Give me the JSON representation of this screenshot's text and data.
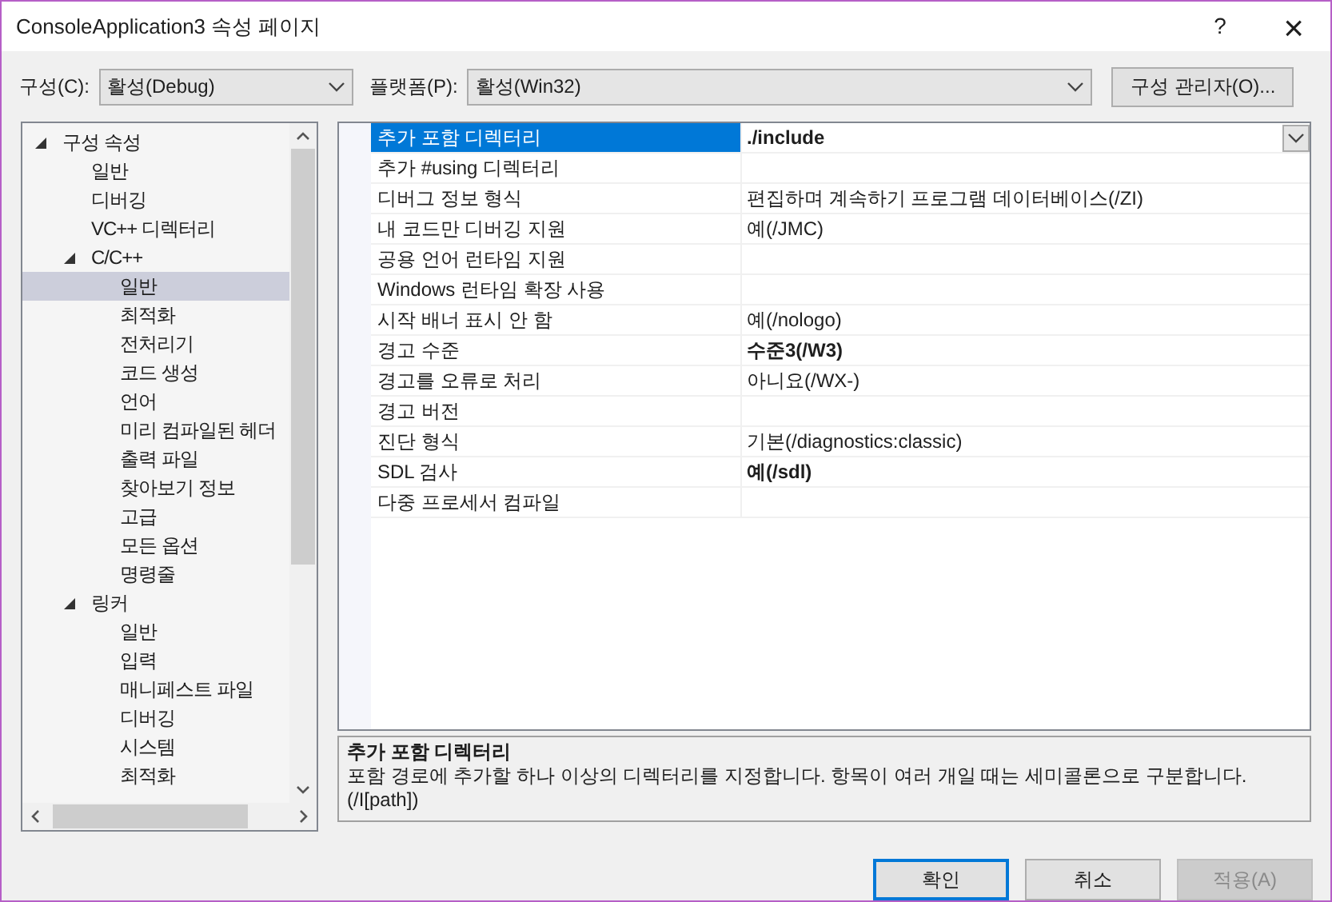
{
  "window": {
    "title": "ConsoleApplication3 속성 페이지",
    "help": "?",
    "close": "×"
  },
  "toolbar": {
    "configuration": {
      "label": "구성(C):",
      "value": "활성(Debug)"
    },
    "platform": {
      "label": "플랫폼(P):",
      "value": "활성(Win32)"
    },
    "manager_button": "구성 관리자(O)..."
  },
  "tree": [
    {
      "label": "구성 속성",
      "expanded": true,
      "selected": false,
      "children": [
        {
          "label": "일반",
          "selected": false
        },
        {
          "label": "디버깅",
          "selected": false
        },
        {
          "label": "VC++ 디렉터리",
          "selected": false
        },
        {
          "label": "C/C++",
          "expanded": true,
          "selected": false,
          "children": [
            {
              "label": "일반",
              "selected": true
            },
            {
              "label": "최적화",
              "selected": false
            },
            {
              "label": "전처리기",
              "selected": false
            },
            {
              "label": "코드 생성",
              "selected": false
            },
            {
              "label": "언어",
              "selected": false
            },
            {
              "label": "미리 컴파일된 헤더",
              "selected": false
            },
            {
              "label": "출력 파일",
              "selected": false
            },
            {
              "label": "찾아보기 정보",
              "selected": false
            },
            {
              "label": "고급",
              "selected": false
            },
            {
              "label": "모든 옵션",
              "selected": false
            },
            {
              "label": "명령줄",
              "selected": false
            }
          ]
        },
        {
          "label": "링커",
          "expanded": true,
          "selected": false,
          "children": [
            {
              "label": "일반",
              "selected": false
            },
            {
              "label": "입력",
              "selected": false
            },
            {
              "label": "매니페스트 파일",
              "selected": false
            },
            {
              "label": "디버깅",
              "selected": false
            },
            {
              "label": "시스템",
              "selected": false
            },
            {
              "label": "최적화",
              "selected": false
            }
          ]
        }
      ]
    }
  ],
  "properties": [
    {
      "name": "추가 포함 디렉터리",
      "value": "./include",
      "bold": true,
      "selected": true
    },
    {
      "name": "추가 #using 디렉터리",
      "selected": false
    },
    {
      "name": "디버그 정보 형식",
      "value": "편집하며 계속하기 프로그램 데이터베이스(/ZI)",
      "bold": false,
      "selected": false
    },
    {
      "name": "내 코드만 디버깅 지원",
      "value": "예(/JMC)",
      "bold": false,
      "selected": false
    },
    {
      "name": "공용 언어 런타임 지원",
      "selected": false
    },
    {
      "name": "Windows 런타임 확장 사용",
      "selected": false
    },
    {
      "name": "시작 배너 표시 안 함",
      "value": "예(/nologo)",
      "bold": false,
      "selected": false
    },
    {
      "name": "경고 수준",
      "value": "수준3(/W3)",
      "bold": true,
      "selected": false
    },
    {
      "name": "경고를 오류로 처리",
      "value": "아니요(/WX-)",
      "bold": false,
      "selected": false
    },
    {
      "name": "경고 버전",
      "selected": false
    },
    {
      "name": "진단 형식",
      "value": "기본(/diagnostics:classic)",
      "bold": false,
      "selected": false
    },
    {
      "name": "SDL 검사",
      "value": "예(/sdl)",
      "bold": true,
      "selected": false
    },
    {
      "name": "다중 프로세서 컴파일",
      "selected": false
    }
  ],
  "description": {
    "title": "추가 포함 디렉터리",
    "text": "포함 경로에 추가할 하나 이상의 디렉터리를 지정합니다. 항목이 여러 개일 때는 세미콜론으로 구분합니다.",
    "flag": "(/I[path])"
  },
  "buttons": [
    {
      "label": "확인",
      "default": true,
      "disabled": false
    },
    {
      "label": "취소",
      "default": false,
      "disabled": false
    },
    {
      "label": "적용(A)",
      "default": false,
      "disabled": true
    }
  ]
}
